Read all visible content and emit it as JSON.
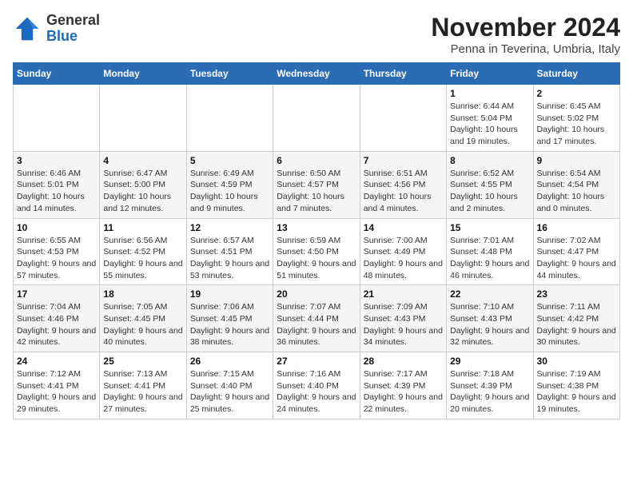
{
  "header": {
    "logo_general": "General",
    "logo_blue": "Blue",
    "title": "November 2024",
    "subtitle": "Penna in Teverina, Umbria, Italy"
  },
  "weekdays": [
    "Sunday",
    "Monday",
    "Tuesday",
    "Wednesday",
    "Thursday",
    "Friday",
    "Saturday"
  ],
  "weeks": [
    [
      {
        "day": "",
        "info": ""
      },
      {
        "day": "",
        "info": ""
      },
      {
        "day": "",
        "info": ""
      },
      {
        "day": "",
        "info": ""
      },
      {
        "day": "",
        "info": ""
      },
      {
        "day": "1",
        "info": "Sunrise: 6:44 AM\nSunset: 5:04 PM\nDaylight: 10 hours and 19 minutes."
      },
      {
        "day": "2",
        "info": "Sunrise: 6:45 AM\nSunset: 5:02 PM\nDaylight: 10 hours and 17 minutes."
      }
    ],
    [
      {
        "day": "3",
        "info": "Sunrise: 6:46 AM\nSunset: 5:01 PM\nDaylight: 10 hours and 14 minutes."
      },
      {
        "day": "4",
        "info": "Sunrise: 6:47 AM\nSunset: 5:00 PM\nDaylight: 10 hours and 12 minutes."
      },
      {
        "day": "5",
        "info": "Sunrise: 6:49 AM\nSunset: 4:59 PM\nDaylight: 10 hours and 9 minutes."
      },
      {
        "day": "6",
        "info": "Sunrise: 6:50 AM\nSunset: 4:57 PM\nDaylight: 10 hours and 7 minutes."
      },
      {
        "day": "7",
        "info": "Sunrise: 6:51 AM\nSunset: 4:56 PM\nDaylight: 10 hours and 4 minutes."
      },
      {
        "day": "8",
        "info": "Sunrise: 6:52 AM\nSunset: 4:55 PM\nDaylight: 10 hours and 2 minutes."
      },
      {
        "day": "9",
        "info": "Sunrise: 6:54 AM\nSunset: 4:54 PM\nDaylight: 10 hours and 0 minutes."
      }
    ],
    [
      {
        "day": "10",
        "info": "Sunrise: 6:55 AM\nSunset: 4:53 PM\nDaylight: 9 hours and 57 minutes."
      },
      {
        "day": "11",
        "info": "Sunrise: 6:56 AM\nSunset: 4:52 PM\nDaylight: 9 hours and 55 minutes."
      },
      {
        "day": "12",
        "info": "Sunrise: 6:57 AM\nSunset: 4:51 PM\nDaylight: 9 hours and 53 minutes."
      },
      {
        "day": "13",
        "info": "Sunrise: 6:59 AM\nSunset: 4:50 PM\nDaylight: 9 hours and 51 minutes."
      },
      {
        "day": "14",
        "info": "Sunrise: 7:00 AM\nSunset: 4:49 PM\nDaylight: 9 hours and 48 minutes."
      },
      {
        "day": "15",
        "info": "Sunrise: 7:01 AM\nSunset: 4:48 PM\nDaylight: 9 hours and 46 minutes."
      },
      {
        "day": "16",
        "info": "Sunrise: 7:02 AM\nSunset: 4:47 PM\nDaylight: 9 hours and 44 minutes."
      }
    ],
    [
      {
        "day": "17",
        "info": "Sunrise: 7:04 AM\nSunset: 4:46 PM\nDaylight: 9 hours and 42 minutes."
      },
      {
        "day": "18",
        "info": "Sunrise: 7:05 AM\nSunset: 4:45 PM\nDaylight: 9 hours and 40 minutes."
      },
      {
        "day": "19",
        "info": "Sunrise: 7:06 AM\nSunset: 4:45 PM\nDaylight: 9 hours and 38 minutes."
      },
      {
        "day": "20",
        "info": "Sunrise: 7:07 AM\nSunset: 4:44 PM\nDaylight: 9 hours and 36 minutes."
      },
      {
        "day": "21",
        "info": "Sunrise: 7:09 AM\nSunset: 4:43 PM\nDaylight: 9 hours and 34 minutes."
      },
      {
        "day": "22",
        "info": "Sunrise: 7:10 AM\nSunset: 4:43 PM\nDaylight: 9 hours and 32 minutes."
      },
      {
        "day": "23",
        "info": "Sunrise: 7:11 AM\nSunset: 4:42 PM\nDaylight: 9 hours and 30 minutes."
      }
    ],
    [
      {
        "day": "24",
        "info": "Sunrise: 7:12 AM\nSunset: 4:41 PM\nDaylight: 9 hours and 29 minutes."
      },
      {
        "day": "25",
        "info": "Sunrise: 7:13 AM\nSunset: 4:41 PM\nDaylight: 9 hours and 27 minutes."
      },
      {
        "day": "26",
        "info": "Sunrise: 7:15 AM\nSunset: 4:40 PM\nDaylight: 9 hours and 25 minutes."
      },
      {
        "day": "27",
        "info": "Sunrise: 7:16 AM\nSunset: 4:40 PM\nDaylight: 9 hours and 24 minutes."
      },
      {
        "day": "28",
        "info": "Sunrise: 7:17 AM\nSunset: 4:39 PM\nDaylight: 9 hours and 22 minutes."
      },
      {
        "day": "29",
        "info": "Sunrise: 7:18 AM\nSunset: 4:39 PM\nDaylight: 9 hours and 20 minutes."
      },
      {
        "day": "30",
        "info": "Sunrise: 7:19 AM\nSunset: 4:38 PM\nDaylight: 9 hours and 19 minutes."
      }
    ]
  ]
}
